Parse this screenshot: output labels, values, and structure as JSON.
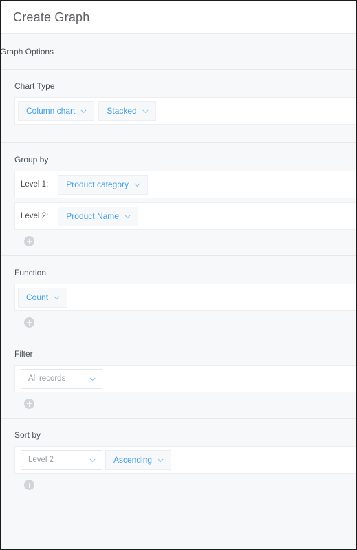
{
  "window": {
    "title": "Create Graph"
  },
  "options_bar": {
    "label": "Graph Options"
  },
  "sections": {
    "chart_type": {
      "label": "Chart Type",
      "chart_kind": "Column chart",
      "chart_style": "Stacked"
    },
    "group_by": {
      "label": "Group by",
      "levels": [
        {
          "prefix": "Level 1:",
          "value": "Product category"
        },
        {
          "prefix": "Level 2:",
          "value": "Product Name"
        }
      ],
      "add_label": "+"
    },
    "function": {
      "label": "Function",
      "value": "Count",
      "add_label": "+"
    },
    "filter": {
      "label": "Filter",
      "value": "All records",
      "add_label": "+"
    },
    "sort_by": {
      "label": "Sort by",
      "field": "Level 2",
      "direction": "Ascending",
      "add_label": "+"
    }
  },
  "icons": {
    "chevron_down": "chevron-down-icon",
    "plus": "plus-icon"
  },
  "colors": {
    "accent_blue": "#42a0e6",
    "text_primary": "#4a4f54",
    "text_muted": "#9aa0a6",
    "panel_bg": "#f7f8fa",
    "card_bg": "#ffffff",
    "border": "#e6e9ec"
  }
}
